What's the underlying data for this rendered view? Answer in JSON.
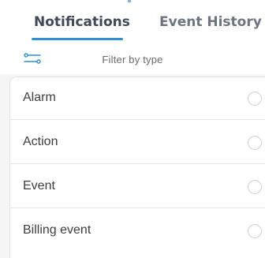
{
  "tabs": [
    {
      "label": "Notifications",
      "active": true
    },
    {
      "label": "Event History",
      "active": false
    }
  ],
  "filter": {
    "label": "Filter by type",
    "icon": "filter-sliders-icon"
  },
  "types": [
    {
      "label": "Alarm",
      "selected": false
    },
    {
      "label": "Action",
      "selected": false
    },
    {
      "label": "Event",
      "selected": false
    },
    {
      "label": "Billing event",
      "selected": false
    }
  ],
  "colors": {
    "accent": "#2f8fd6",
    "active_tab_text": "#3f4a56",
    "inactive_tab_text": "#6c7580"
  }
}
